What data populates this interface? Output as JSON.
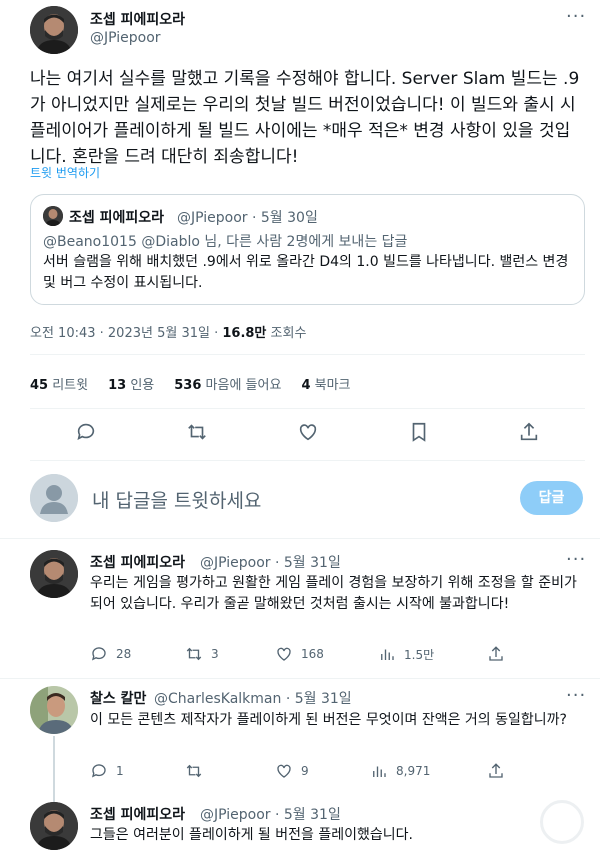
{
  "main_tweet": {
    "author_name": "조셉 피에피오라",
    "handle": "@JPiepoor",
    "more": "···",
    "text": "나는 여기서 실수를 말했고 기록을 수정해야 합니다. Server Slam 빌드는 .9가 아니었지만 실제로는 우리의 첫날 빌드 버전이었습니다! 이 빌드와 출시 시 플레이어가 플레이하게 될 빌드 사이에는 *매우 적은* 변경 사항이 있을 것입니다. 혼란을 드려 대단히 죄송합니다!",
    "translate": "트윗 번역하기",
    "quote": {
      "author_name": "조셉 피에피오라",
      "handle_date": "@JPiepoor · 5월 30일",
      "replying": "@Beano1015 @Diablo  님, 다른 사람 2명에게 보내는 답글",
      "text": "서버 슬램을 위해 배치했던 .9에서 위로 올라간 D4의 1.0 빌드를 나타냅니다. 밸런스 변경 및 버그 수정이 표시됩니다."
    },
    "meta_time": "오전 10:43 · 2023년 5월 31일 · ",
    "meta_views": "16.8만",
    "meta_views_label": " 조회수",
    "stats": {
      "retweets": "45",
      "retweets_label": " 리트윗",
      "quotes": "13",
      "quotes_label": " 인용",
      "likes": "536",
      "likes_label": " 마음에 들어요",
      "bookmarks": "4",
      "bookmarks_label": " 북마크"
    }
  },
  "compose": {
    "placeholder": "내 답글을 트윗하세요",
    "button": "답글"
  },
  "replies": [
    {
      "author_name": "조셉 피에피오라",
      "handle_date": "@JPiepoor · 5월 31일",
      "text": "우리는 게임을 평가하고 원활한 게임 플레이 경험을 보장하기 위해 조정을 할 준비가 되어 있습니다. 우리가 줄곧 말해왔던 것처럼 출시는 시작에 불과합니다!",
      "reply_count": "28",
      "retweet_count": "3",
      "like_count": "168",
      "view_count": "1.5만"
    },
    {
      "author_name": "찰스 칼만",
      "handle_date": "@CharlesKalkman · 5월 31일",
      "text": "이 모든 콘텐츠 제작자가 플레이하게 된 버전은 무엇이며 잔액은 거의 동일합니까?",
      "reply_count": "1",
      "retweet_count": "",
      "like_count": "9",
      "view_count": "8,971"
    },
    {
      "author_name": "조셉 피에피오라",
      "handle_date": "@JPiepoor · 5월 31일",
      "text": "그들은 여러분이 플레이하게 될 버전을 플레이했습니다."
    }
  ]
}
